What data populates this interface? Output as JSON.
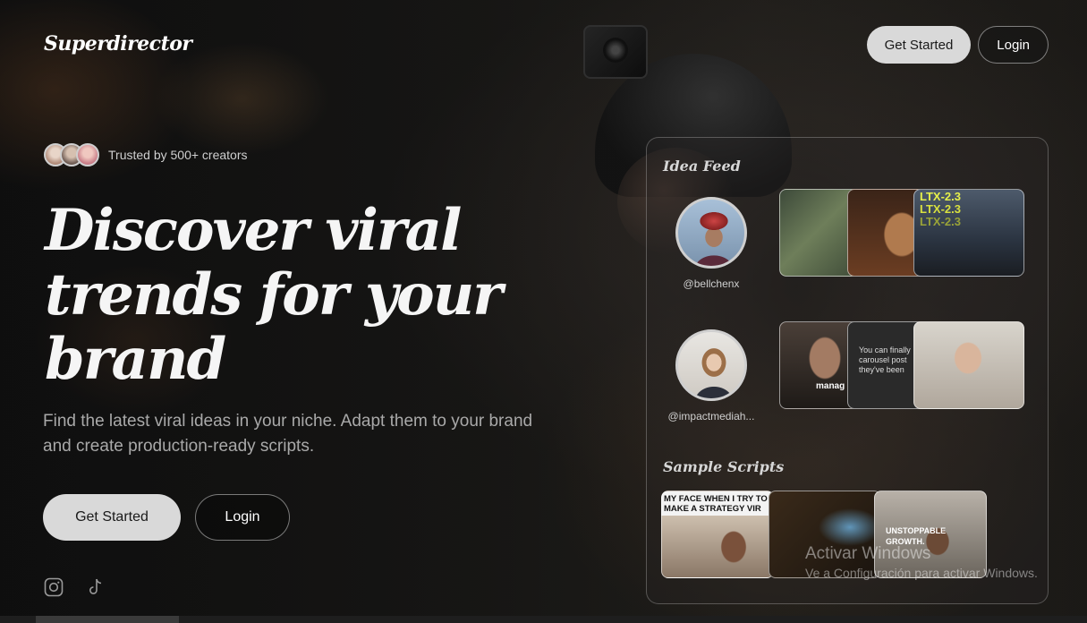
{
  "brand": {
    "name": "Superdirector"
  },
  "header": {
    "get_started": "Get Started",
    "login": "Login"
  },
  "hero": {
    "trusted": "Trusted by 500+ creators",
    "headline": "Discover viral trends for your brand",
    "subtitle": "Find the latest viral ideas in your niche. Adapt them to your brand and create production-ready scripts.",
    "get_started": "Get Started",
    "login": "Login"
  },
  "socials": {
    "icons": [
      "instagram-icon",
      "tiktok-icon"
    ]
  },
  "panel": {
    "idea_feed_title": "Idea Feed",
    "creators": [
      {
        "handle": "@bellchenx",
        "thumb_captions": [
          "LTX-2.3",
          "LTX-2.3",
          "LTX-2.3"
        ]
      },
      {
        "handle": "@impactmediah...",
        "thumb_captions": [
          "manag",
          "You can finally carousel post they've been"
        ]
      }
    ],
    "sample_scripts_title": "Sample Scripts",
    "scripts_captions": [
      "MY FACE WHEN I TRY TO MAKE A STRATEGY VIR",
      "UNSTOPPABLE GROWTH."
    ]
  },
  "watermark": {
    "line1": "Activar Windows",
    "line2": "Ve a Configuración para activar Windows."
  },
  "colors": {
    "background": "#161614",
    "button_light": "#d9d9d9",
    "text_muted": "#a9a9a9"
  }
}
